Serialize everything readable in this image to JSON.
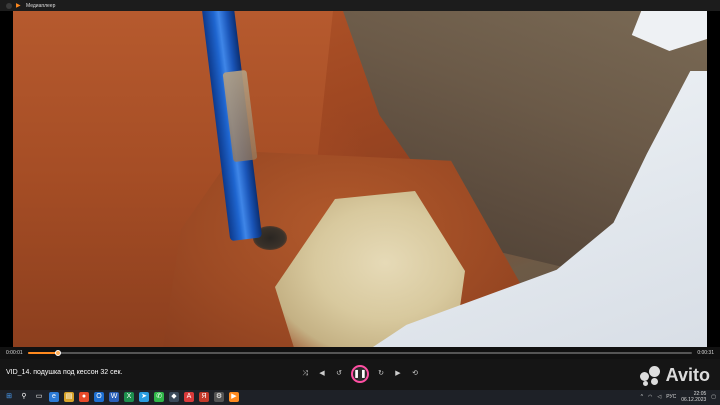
{
  "window": {
    "title": "Медиаплеер",
    "app_icon": "play-icon"
  },
  "player": {
    "time_current": "0:00:01",
    "time_total": "0:00:31",
    "progress_fraction": 0.045,
    "video_title": "VID_14. подушка под кессон 32 сек.",
    "accent_color": "#ff8a1f"
  },
  "watermark": {
    "text": "Avito"
  },
  "taskbar": {
    "language": "РУС",
    "time": "22:05",
    "date": "06.12.2023"
  }
}
